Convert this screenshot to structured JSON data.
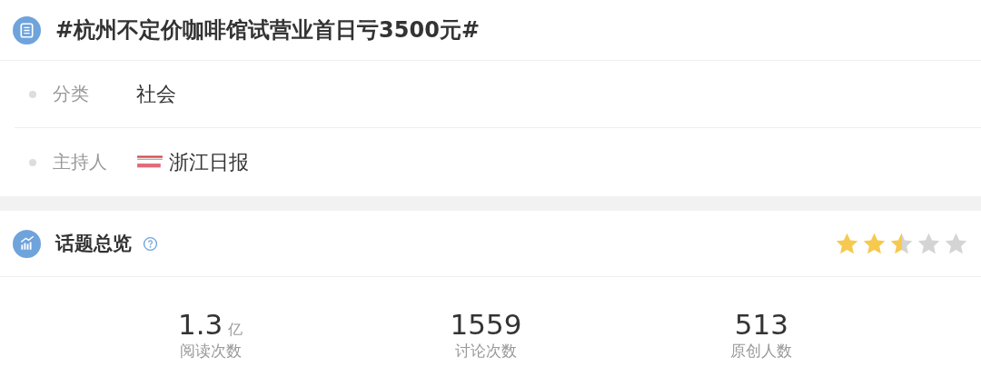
{
  "topic": {
    "title": "#杭州不定价咖啡馆试营业首日亏3500元#"
  },
  "info": [
    {
      "label": "分类",
      "value": "社会",
      "kind": "text"
    },
    {
      "label": "主持人",
      "value": "浙江日报",
      "kind": "host"
    }
  ],
  "overview": {
    "title": "话题总览",
    "stars": 2.5
  },
  "stats": [
    {
      "value": "1.3",
      "unit": "亿",
      "label": "阅读次数"
    },
    {
      "value": "1559",
      "label": "讨论次数"
    },
    {
      "value": "513",
      "label": "原创人数"
    }
  ]
}
